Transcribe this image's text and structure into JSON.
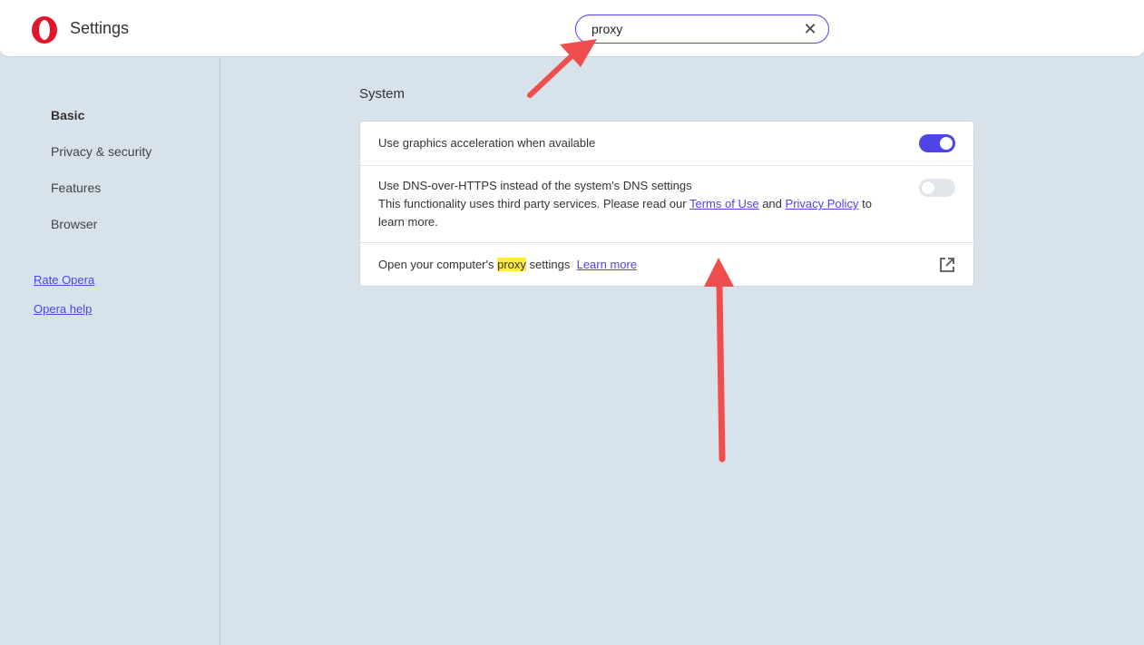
{
  "header": {
    "title": "Settings",
    "logo_icon": "opera-logo-icon",
    "search": {
      "value": "proxy",
      "placeholder": "",
      "clear_glyph": "✕"
    }
  },
  "sidebar": {
    "items": [
      {
        "label": "Basic",
        "active": true
      },
      {
        "label": "Privacy & security",
        "active": false
      },
      {
        "label": "Features",
        "active": false
      },
      {
        "label": "Browser",
        "active": false
      }
    ],
    "links": [
      {
        "label": "Rate Opera"
      },
      {
        "label": "Opera help"
      }
    ]
  },
  "main": {
    "section_title": "System",
    "rows": {
      "graphics": {
        "label": "Use graphics acceleration when available",
        "enabled": true
      },
      "dns": {
        "title": "Use DNS-over-HTTPS instead of the system's DNS settings",
        "desc_start": "This functionality uses third party services. Please read our",
        "terms_link": "Terms of Use",
        "and_text": "and",
        "privacy_link": "Privacy Policy",
        "desc_end": "to learn more.",
        "enabled": false
      },
      "proxy": {
        "before": "Open your computer's",
        "highlight": "proxy",
        "after": "settings",
        "learn_more": "Learn more",
        "icon": "external-link-icon"
      }
    }
  },
  "colors": {
    "accent": "#4f44e6",
    "annotation_arrow": "#f04e4e",
    "highlight": "#ffeb3b",
    "background": "#d8e2eb"
  }
}
